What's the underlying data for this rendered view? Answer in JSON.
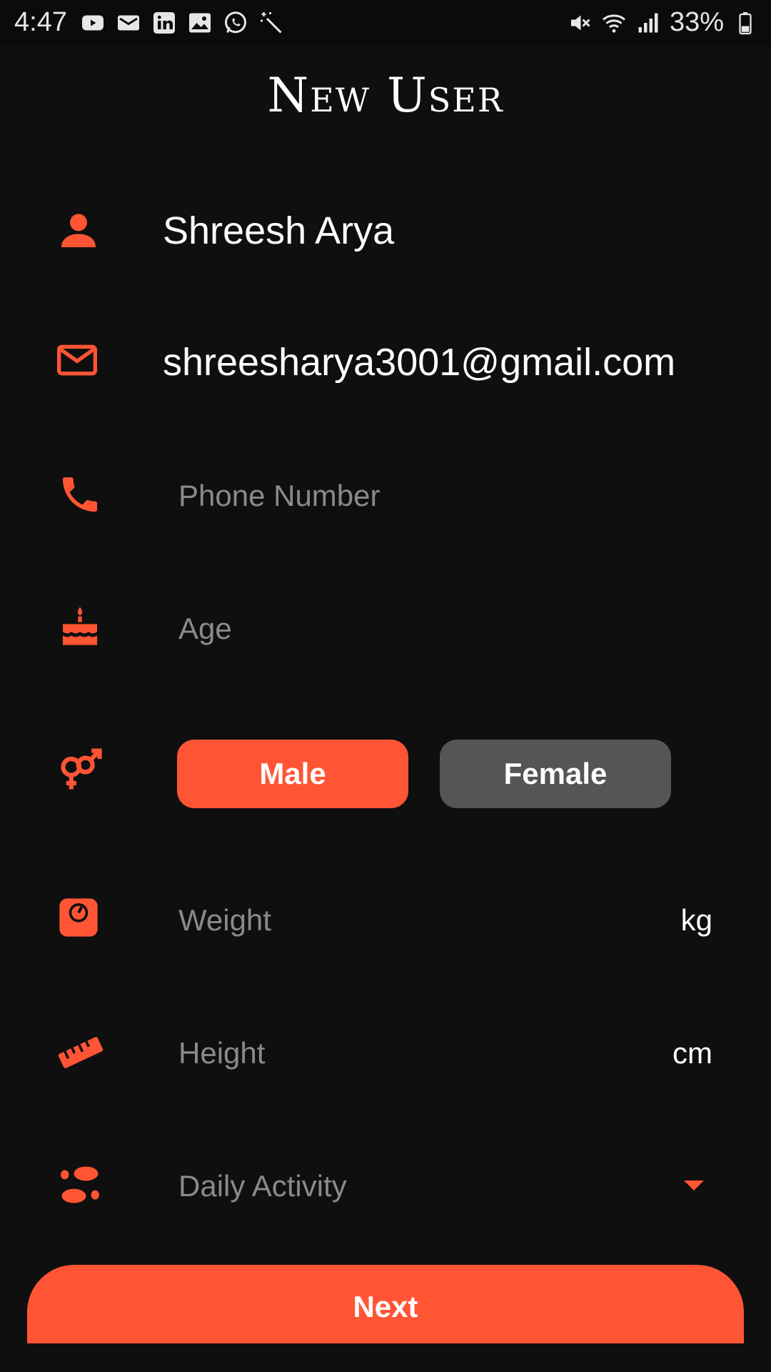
{
  "status_bar": {
    "time": "4:47",
    "battery": "33%",
    "left_icons": [
      "youtube-icon",
      "gmail-icon",
      "linkedin-icon",
      "gallery-icon",
      "whatsapp-icon",
      "magic-wand-icon"
    ],
    "right_icons": [
      "mute-icon",
      "wifi-icon",
      "signal-icon",
      "battery-icon"
    ]
  },
  "page": {
    "title": "New User"
  },
  "form": {
    "name": {
      "value": "Shreesh Arya",
      "icon": "person-icon"
    },
    "email": {
      "value": "shreesharya3001@gmail.com",
      "icon": "mail-icon"
    },
    "phone": {
      "placeholder": "Phone Number",
      "icon": "phone-icon"
    },
    "age": {
      "placeholder": "Age",
      "icon": "cake-icon"
    },
    "gender": {
      "icon": "gender-icon",
      "male_label": "Male",
      "female_label": "Female",
      "selected": "Male"
    },
    "weight": {
      "placeholder": "Weight",
      "unit": "kg",
      "icon": "scale-icon"
    },
    "height": {
      "placeholder": "Height",
      "unit": "cm",
      "icon": "ruler-icon"
    },
    "activity": {
      "placeholder": "Daily Activity",
      "icon": "footsteps-icon",
      "dropdown_icon": "dropdown-arrow-icon"
    }
  },
  "actions": {
    "next_label": "Next"
  },
  "colors": {
    "accent": "#ff5535",
    "background": "#0f0f0f",
    "button_inactive": "#555555",
    "placeholder": "#8a8a8a"
  }
}
